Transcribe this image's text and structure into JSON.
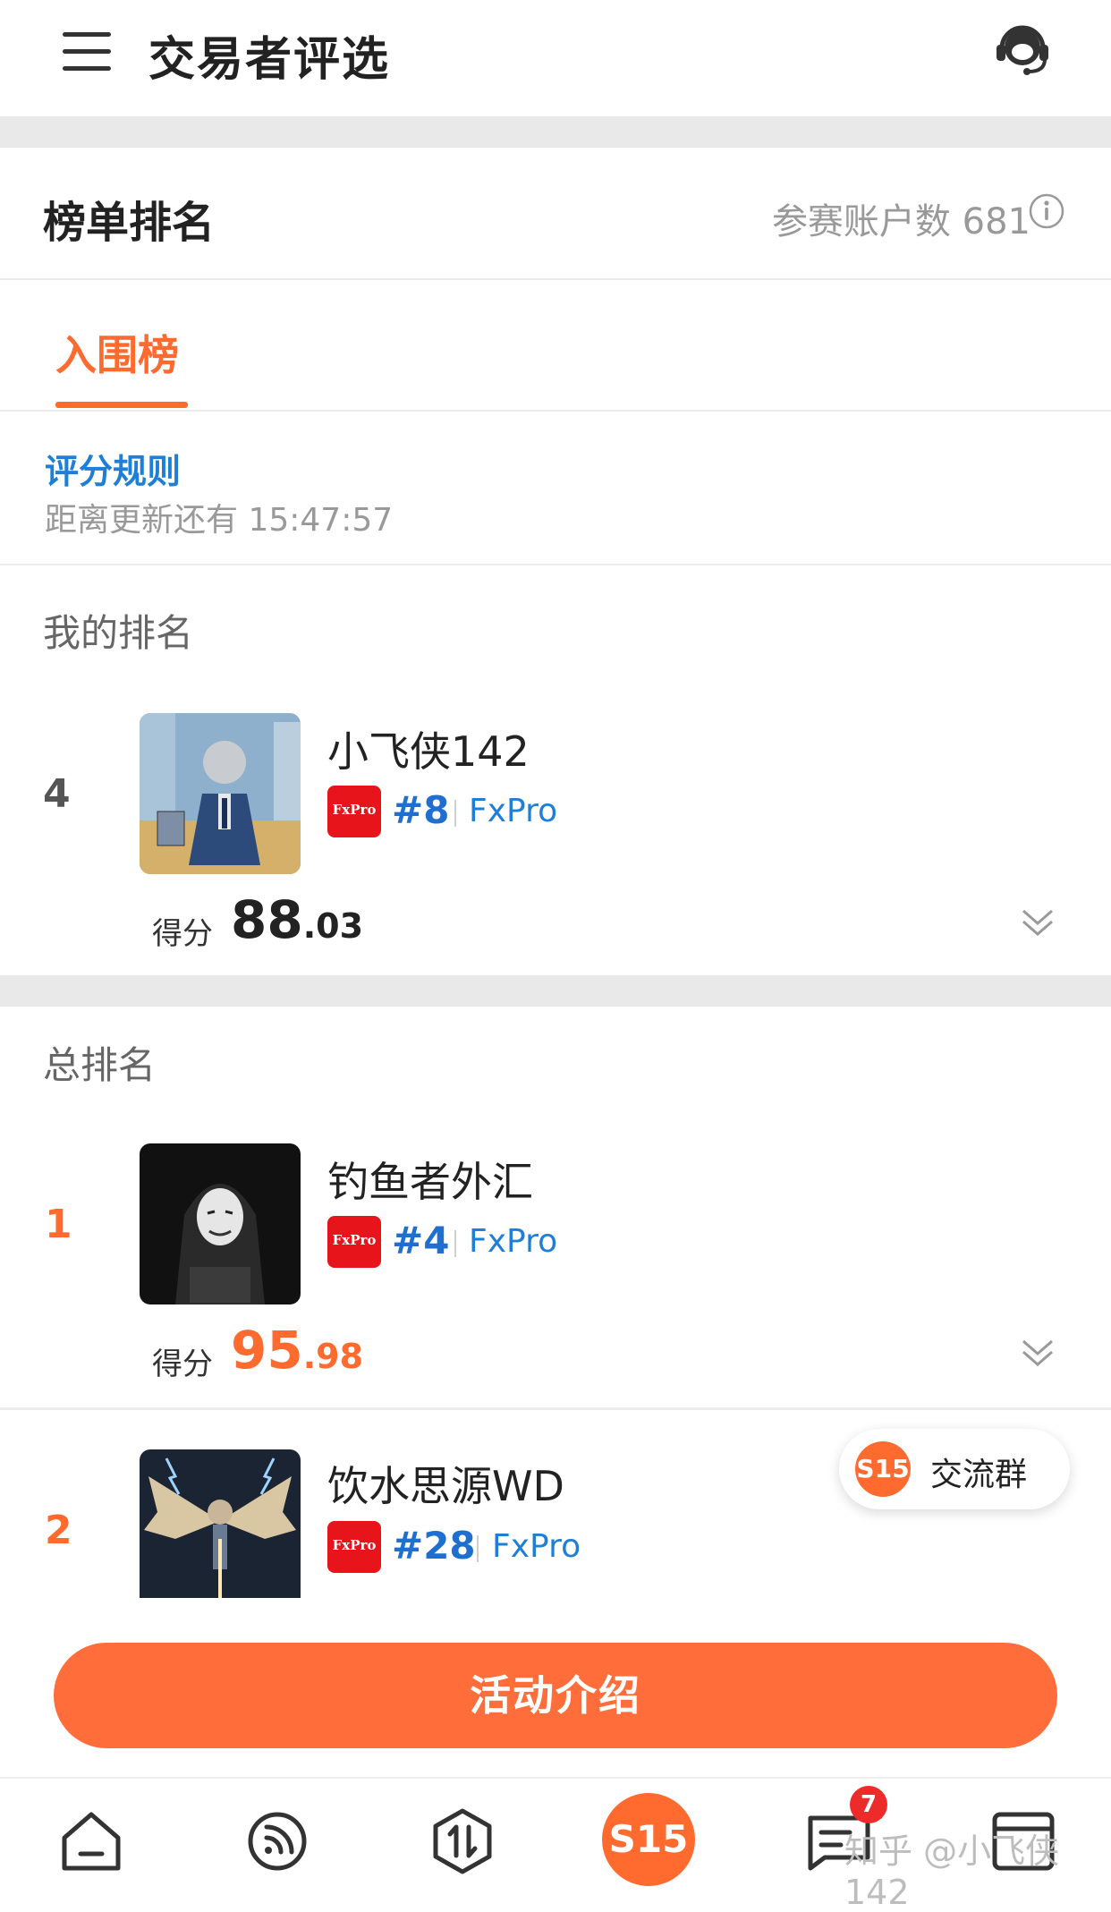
{
  "header": {
    "title": "交易者评选"
  },
  "ranking": {
    "title": "榜单排名",
    "participants_label": "参赛账户数 681"
  },
  "tabs": [
    {
      "label": "入围榜",
      "active": true
    }
  ],
  "rules": {
    "link": "评分规则",
    "countdown": "距离更新还有 15:47:57"
  },
  "my_ranking": {
    "label": "我的排名",
    "entry": {
      "rank": "4",
      "name": "小飞侠142",
      "broker_logo": "FxPro",
      "broker_rank": "#8",
      "broker": "FxPro",
      "score_label": "得分",
      "score_int": "88",
      "score_dec": ".03"
    }
  },
  "total_ranking": {
    "label": "总排名",
    "entries": [
      {
        "rank": "1",
        "name": "钓鱼者外汇",
        "broker_logo": "FxPro",
        "broker_rank": "#4",
        "broker": "FxPro",
        "score_label": "得分",
        "score_int": "95",
        "score_dec": ".98"
      },
      {
        "rank": "2",
        "name": "饮水思源WD",
        "broker_logo": "FxPro",
        "broker_rank": "#28",
        "broker": "FxPro"
      }
    ]
  },
  "floating_group": {
    "icon_text": "S15",
    "label": "交流群"
  },
  "action": {
    "button_label": "活动介绍"
  },
  "bottom_nav": {
    "center_label": "S15",
    "badge": "7",
    "watermark": "知乎 @小飞侠142",
    "items": [
      "home-icon",
      "feed-icon",
      "trade-icon",
      "s15-center",
      "message-icon",
      "chart-icon"
    ]
  },
  "colors": {
    "accent": "#ff6a2f",
    "link": "#1f7fd6",
    "broker_red": "#e8141b",
    "muted": "#999999"
  }
}
